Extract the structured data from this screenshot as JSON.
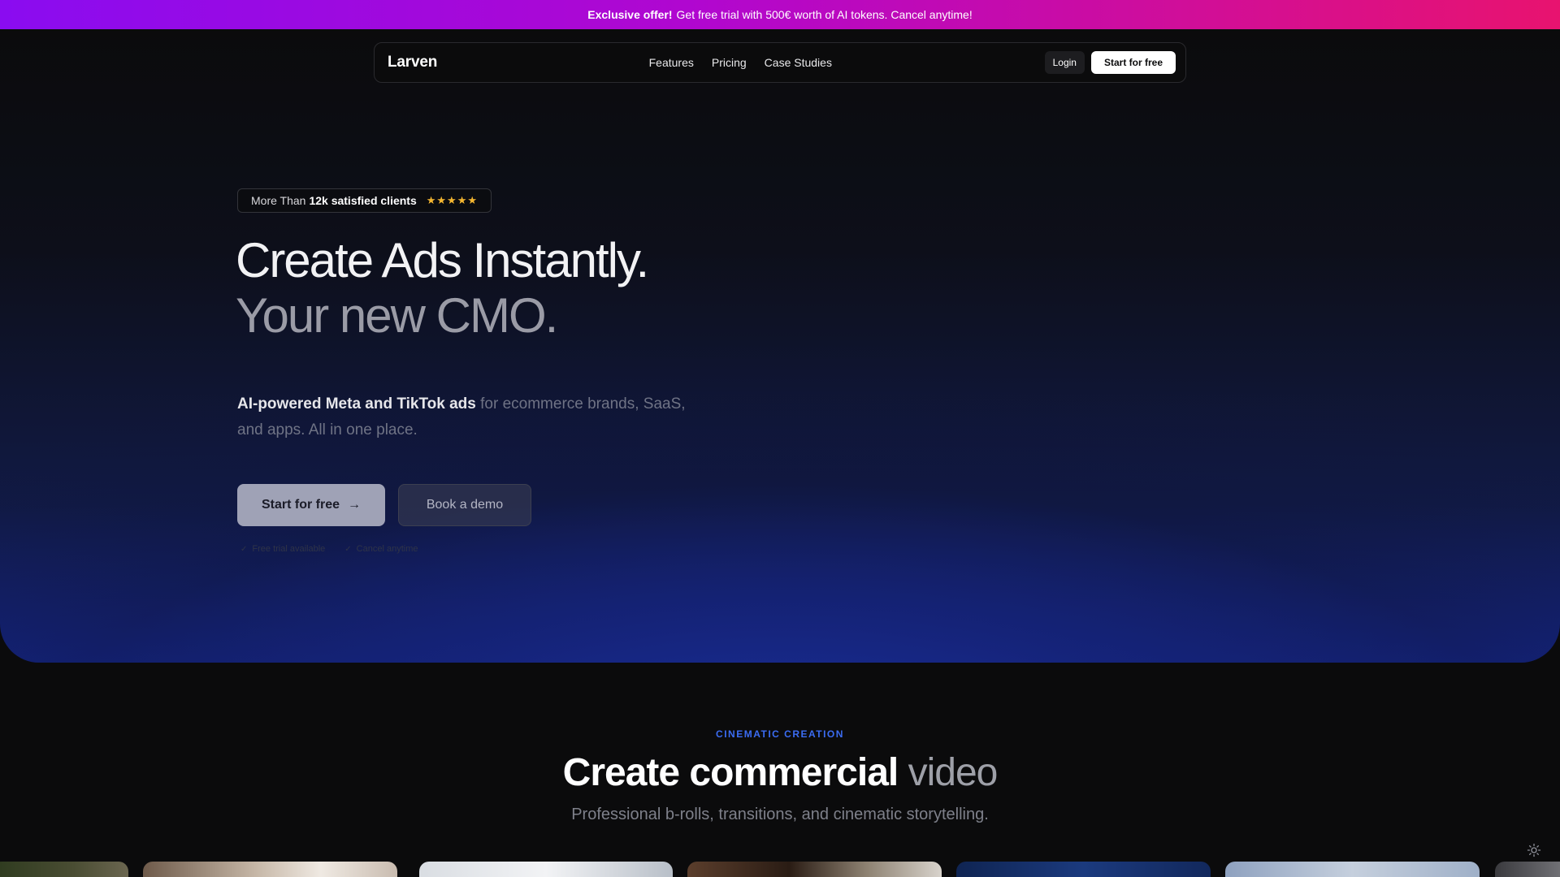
{
  "promo": {
    "highlight": "Exclusive offer!",
    "text": "Get free trial with 500€ worth of AI tokens. Cancel anytime!"
  },
  "nav": {
    "logo": "Larven",
    "links": [
      "Features",
      "Pricing",
      "Case Studies"
    ],
    "login": "Login",
    "start": "Start for free"
  },
  "hero": {
    "rating_prefix": "More Than",
    "rating_highlight": "12k satisfied clients",
    "stars": "★★★★★",
    "title_line1": "Create Ads Instantly.",
    "title_line2": "Your new CMO.",
    "subtitle_strong": "AI-powered Meta and TikTok ads",
    "subtitle_rest": "for ecommerce brands, SaaS, and apps. All in one place.",
    "cta_primary": "Start for free",
    "cta_primary_arrow": "→",
    "cta_secondary": "Book a demo",
    "notes": [
      "Free trial available",
      "Cancel anytime"
    ]
  },
  "section": {
    "kicker": "CINEMATIC CREATION",
    "title_bold": "Create commercial",
    "title_light": "video",
    "subtitle": "Professional b-rolls, transitions, and cinematic storytelling."
  },
  "colors": {
    "accent": "#3b6cf2",
    "promo_start": "#8a0cf0",
    "promo_end": "#e8136f",
    "star": "#f5b731"
  },
  "icons": {
    "theme_toggle": "sun-icon",
    "check": "check-icon",
    "arrow": "arrow-right-icon"
  }
}
